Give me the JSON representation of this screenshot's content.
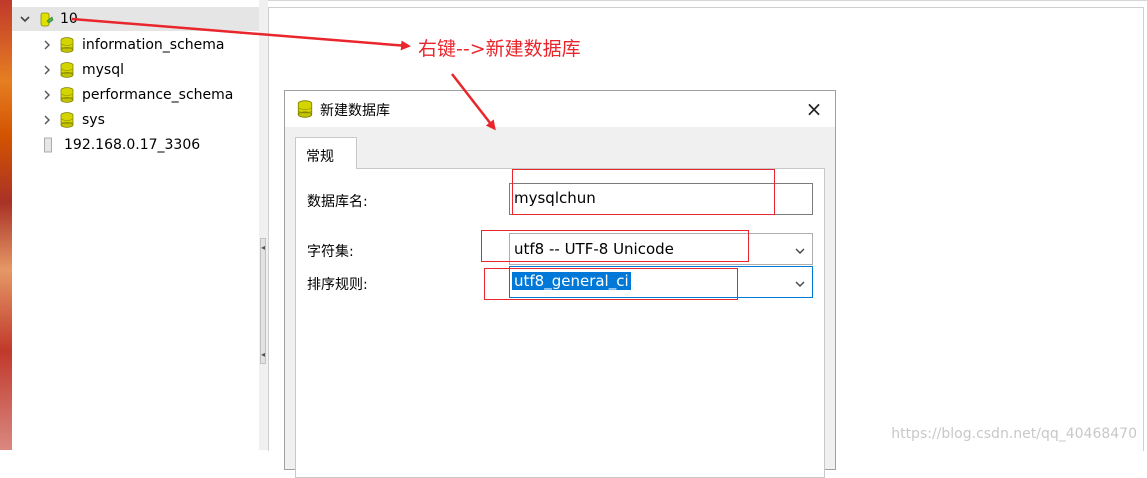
{
  "tree": {
    "items": [
      {
        "label": "10",
        "type": "connection",
        "expanded": true,
        "selected": true
      },
      {
        "label": "information_schema",
        "type": "database"
      },
      {
        "label": "mysql",
        "type": "database"
      },
      {
        "label": "performance_schema",
        "type": "database"
      },
      {
        "label": "sys",
        "type": "database"
      },
      {
        "label": "192.168.0.17_3306",
        "type": "connection-closed"
      }
    ]
  },
  "annotation": {
    "text": "右键-->新建数据库",
    "color": "#e8262c"
  },
  "dialog": {
    "title": "新建数据库",
    "close_icon": "×",
    "tab_label": "常规",
    "db_name_label": "数据库名:",
    "db_name_value": "mysqlchun",
    "charset_label": "字符集:",
    "charset_value": "utf8 -- UTF-8 Unicode",
    "collation_label": "排序规则:",
    "collation_value": "utf8_general_ci"
  },
  "watermark": "https://blog.csdn.net/qq_40468470",
  "colors": {
    "selection": "#0078d7",
    "annotation": "#e8262c",
    "db_icon": "#d4d400"
  }
}
